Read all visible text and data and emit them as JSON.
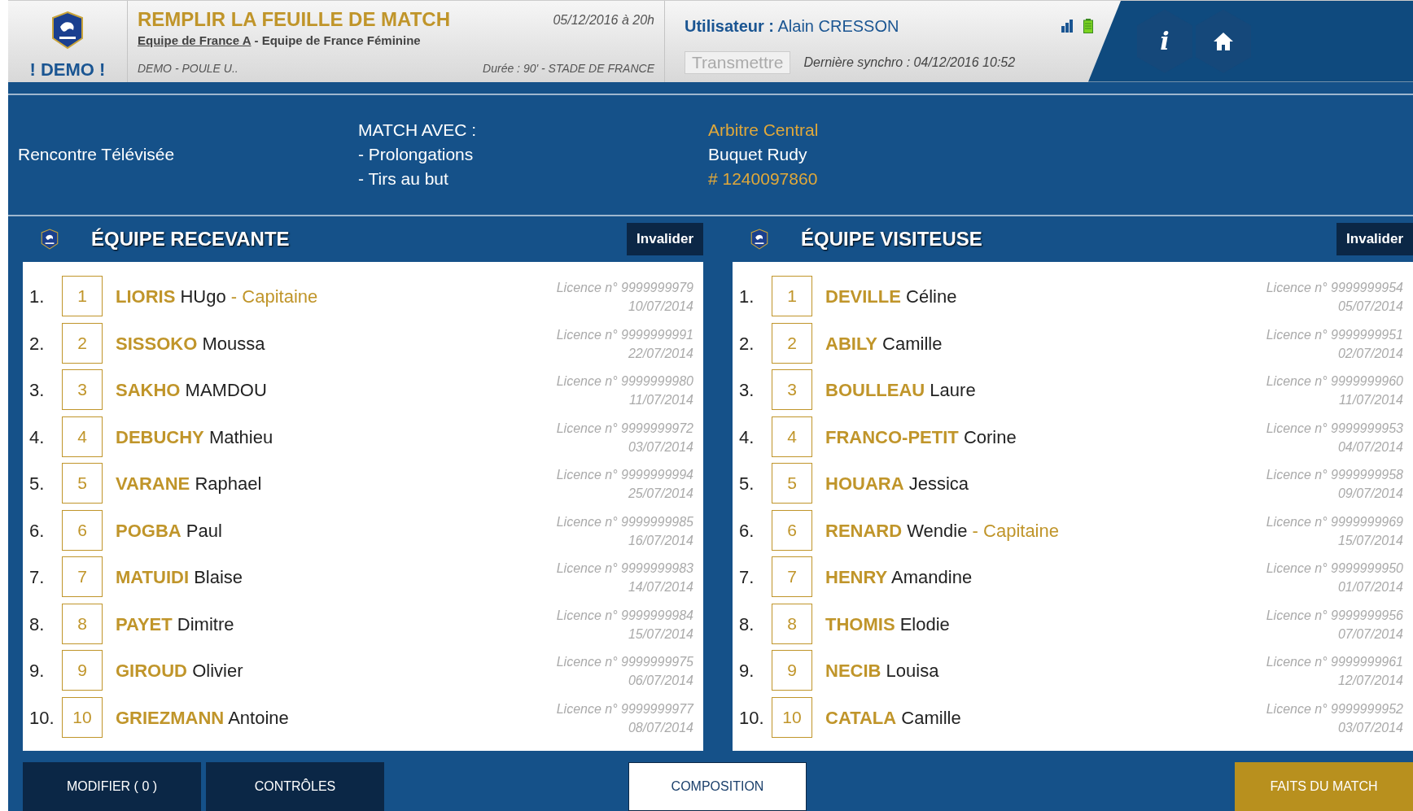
{
  "header": {
    "demo_label": "! DEMO !",
    "title": "REMPLIR LA FEUILLE DE MATCH",
    "home_team_link": "Equipe de France A",
    "teams_rest": "- Equipe de France Féminine",
    "date": "05/12/2016 à 20h",
    "competition": "DEMO - POULE U..",
    "duration_venue": "Durée : 90' - STADE DE FRANCE",
    "user_label": "Utilisateur :",
    "user_name": "Alain CRESSON",
    "transmit_button": {
      "label": "Transmettre",
      "disabled": true
    },
    "last_sync": "Dernière synchro : 04/12/2016 10:52",
    "info_button": "i"
  },
  "match_info": {
    "broadcast": "Rencontre Télévisée",
    "with_label": "MATCH AVEC :",
    "with_items": [
      "- Prolongations",
      "- Tirs au but"
    ],
    "referee_role": "Arbitre Central",
    "referee_name": "Buquet Rudy",
    "referee_id": "# 1240097860"
  },
  "teams": [
    {
      "title": "ÉQUIPE RECEVANTE",
      "invalidate_button": "Invalider",
      "players": [
        {
          "index": "1.",
          "number": "1",
          "last_name": "LIORIS",
          "first_name": "HUgo",
          "captain": "- Capitaine",
          "licence": "Licence n° 9999999979",
          "date": "10/07/2014"
        },
        {
          "index": "2.",
          "number": "2",
          "last_name": "SISSOKO",
          "first_name": "Moussa",
          "licence": "Licence n° 9999999991",
          "date": "22/07/2014"
        },
        {
          "index": "3.",
          "number": "3",
          "last_name": "SAKHO",
          "first_name": "MAMDOU",
          "licence": "Licence n° 9999999980",
          "date": "11/07/2014"
        },
        {
          "index": "4.",
          "number": "4",
          "last_name": "DEBUCHY",
          "first_name": "Mathieu",
          "licence": "Licence n° 9999999972",
          "date": "03/07/2014"
        },
        {
          "index": "5.",
          "number": "5",
          "last_name": "VARANE",
          "first_name": "Raphael",
          "licence": "Licence n° 9999999994",
          "date": "25/07/2014"
        },
        {
          "index": "6.",
          "number": "6",
          "last_name": "POGBA",
          "first_name": "Paul",
          "licence": "Licence n° 9999999985",
          "date": "16/07/2014"
        },
        {
          "index": "7.",
          "number": "7",
          "last_name": "MATUIDI",
          "first_name": "Blaise",
          "licence": "Licence n° 9999999983",
          "date": "14/07/2014"
        },
        {
          "index": "8.",
          "number": "8",
          "last_name": "PAYET",
          "first_name": "Dimitre",
          "licence": "Licence n° 9999999984",
          "date": "15/07/2014"
        },
        {
          "index": "9.",
          "number": "9",
          "last_name": "GIROUD",
          "first_name": "Olivier",
          "licence": "Licence n° 9999999975",
          "date": "06/07/2014"
        },
        {
          "index": "10.",
          "number": "10",
          "last_name": "GRIEZMANN",
          "first_name": "Antoine",
          "licence": "Licence n° 9999999977",
          "date": "08/07/2014"
        }
      ]
    },
    {
      "title": "ÉQUIPE VISITEUSE",
      "invalidate_button": "Invalider",
      "players": [
        {
          "index": "1.",
          "number": "1",
          "last_name": "DEVILLE",
          "first_name": "Céline",
          "licence": "Licence n° 9999999954",
          "date": "05/07/2014"
        },
        {
          "index": "2.",
          "number": "2",
          "last_name": "ABILY",
          "first_name": "Camille",
          "licence": "Licence n° 9999999951",
          "date": "02/07/2014"
        },
        {
          "index": "3.",
          "number": "3",
          "last_name": "BOULLEAU",
          "first_name": "Laure",
          "licence": "Licence n° 9999999960",
          "date": "11/07/2014"
        },
        {
          "index": "4.",
          "number": "4",
          "last_name": "FRANCO-PETIT",
          "first_name": "Corine",
          "licence": "Licence n° 9999999953",
          "date": "04/07/2014"
        },
        {
          "index": "5.",
          "number": "5",
          "last_name": "HOUARA",
          "first_name": "Jessica",
          "licence": "Licence n° 9999999958",
          "date": "09/07/2014"
        },
        {
          "index": "6.",
          "number": "6",
          "last_name": "RENARD",
          "first_name": "Wendie",
          "captain": "- Capitaine",
          "licence": "Licence n° 9999999969",
          "date": "15/07/2014"
        },
        {
          "index": "7.",
          "number": "7",
          "last_name": "HENRY",
          "first_name": "Amandine",
          "licence": "Licence n° 9999999950",
          "date": "01/07/2014"
        },
        {
          "index": "8.",
          "number": "8",
          "last_name": "THOMIS",
          "first_name": "Elodie",
          "licence": "Licence n° 9999999956",
          "date": "07/07/2014"
        },
        {
          "index": "9.",
          "number": "9",
          "last_name": "NECIB",
          "first_name": "Louisa",
          "licence": "Licence n° 9999999961",
          "date": "12/07/2014"
        },
        {
          "index": "10.",
          "number": "10",
          "last_name": "CATALA",
          "first_name": "Camille",
          "licence": "Licence n° 9999999952",
          "date": "03/07/2014"
        }
      ]
    }
  ],
  "bottom_buttons": [
    {
      "label": "MODIFIER ( 0 )",
      "kind": "nav",
      "selected": false
    },
    {
      "label": "CONTRÔLES",
      "kind": "nav",
      "selected": false
    },
    {
      "label": "COMPOSITION",
      "kind": "nav",
      "selected": true
    },
    {
      "label": "FAITS DU MATCH",
      "kind": "next",
      "selected": false
    }
  ]
}
